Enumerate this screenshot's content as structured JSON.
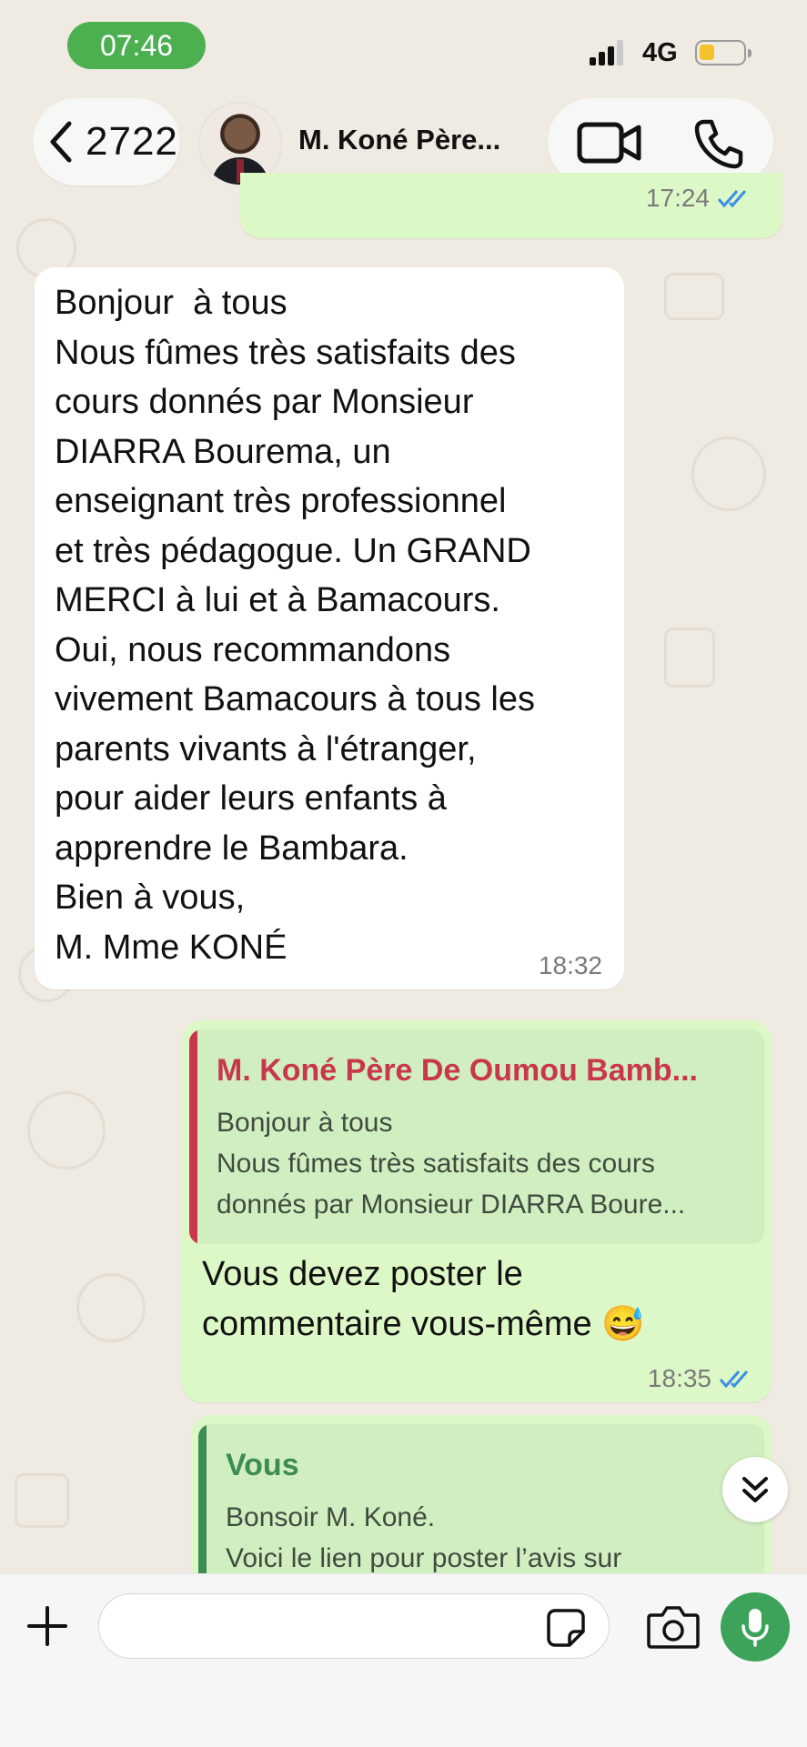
{
  "status_bar": {
    "time": "07:46",
    "network": "4G",
    "battery_icon": "battery-low-icon"
  },
  "header": {
    "back_count": "2722",
    "contact_name": "M. Koné Père...",
    "video_icon": "video-camera-icon",
    "call_icon": "phone-icon"
  },
  "messages": [
    {
      "id": "top",
      "direction": "outgoing",
      "time": "17:24",
      "read": true
    },
    {
      "id": "m1",
      "direction": "incoming",
      "lines": [
        "Bonjour  à tous",
        "Nous fûmes très satisfaits des",
        "cours donnés par Monsieur",
        "DIARRA Bourema, un",
        "enseignant très professionnel",
        "et très pédagogue. Un GRAND",
        "MERCI à lui et à Bamacours.",
        "Oui, nous recommandons",
        "vivement Bamacours à tous les",
        "parents vivants à l'étranger,",
        "pour aider leurs enfants à",
        "apprendre le Bambara.",
        "Bien à vous,",
        "M. Mme KONÉ"
      ],
      "time": "18:32"
    },
    {
      "id": "m2",
      "direction": "outgoing",
      "quote": {
        "author": "M. Koné Père De Oumou Bamb...",
        "lines": [
          "Bonjour  à tous",
          "Nous fûmes très satisfaits des cours",
          "donnés par Monsieur DIARRA Boure..."
        ]
      },
      "lines": [
        "Vous devez poster le",
        "commentaire vous-même 😅"
      ],
      "time": "18:35",
      "read": true
    },
    {
      "id": "m3",
      "direction": "outgoing",
      "quote": {
        "author": "Vous",
        "lines": [
          "Bonsoir M. Koné.",
          "Voici le lien pour poster l’avis sur"
        ]
      }
    }
  ],
  "composer": {
    "value": "",
    "placeholder": ""
  },
  "colors": {
    "outgoing_bubble": "#dcf8c6",
    "incoming_bubble": "#ffffff",
    "quote_bar_contact": "#c8374b",
    "quote_author_contact": "#c8374b",
    "quote_author_self": "#3d8b55",
    "read_ticks": "#3a8ee6",
    "mic_button": "#3da35a",
    "time_pill": "#4caf50"
  }
}
